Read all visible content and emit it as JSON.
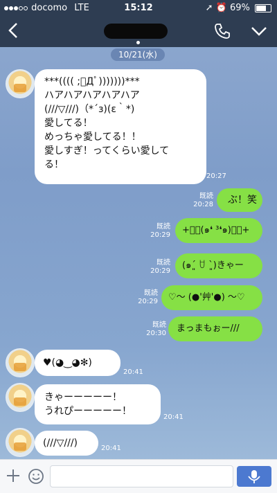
{
  "status_bar": {
    "carrier": "docomo",
    "network": "LTE",
    "time": "15:12",
    "battery": "69%",
    "battery_level": 0.69
  },
  "header": {
    "date_label": "10/21(水)"
  },
  "messages": [
    {
      "side": "left",
      "text": "***(((( ;ﾟДﾟ)))))))***\nハアハアハアハアハア\n(///▽///)（*´з)(ε｀*)\n愛してる！\nめっちゃ愛してる！！\n愛しすぎ！ってくらい愛して\nる！",
      "time": "20:27"
    },
    {
      "side": "right",
      "read": "既読",
      "time": "20:28",
      "text": "ぶ！笑"
    },
    {
      "side": "right",
      "read": "既読",
      "time": "20:29",
      "text": "+ﾟ･(๑❛ ³❛๑)ﾟ･+"
    },
    {
      "side": "right",
      "read": "既読",
      "time": "20:29",
      "text": "(๑ˊ͈ ꇴ ˋ͈)きゃー"
    },
    {
      "side": "right",
      "read": "既読",
      "time": "20:29",
      "text": "♡〜 (●'艸'●) 〜♡"
    },
    {
      "side": "right",
      "read": "既読",
      "time": "20:30",
      "text": "まっまもぉー///"
    },
    {
      "side": "left",
      "text": "♥(◕‿◕✻)",
      "time": "20:41"
    },
    {
      "side": "left",
      "text": "きゃーーーーー！\nうれぴーーーーー！",
      "time": "20:41"
    },
    {
      "side": "left",
      "text": "(///▽///)",
      "time": "20:41"
    }
  ],
  "colors": {
    "header_bg": "#2e3d52",
    "bubble_out": "#86e045",
    "bubble_in": "#ffffff",
    "send_button": "#4c79d0"
  }
}
